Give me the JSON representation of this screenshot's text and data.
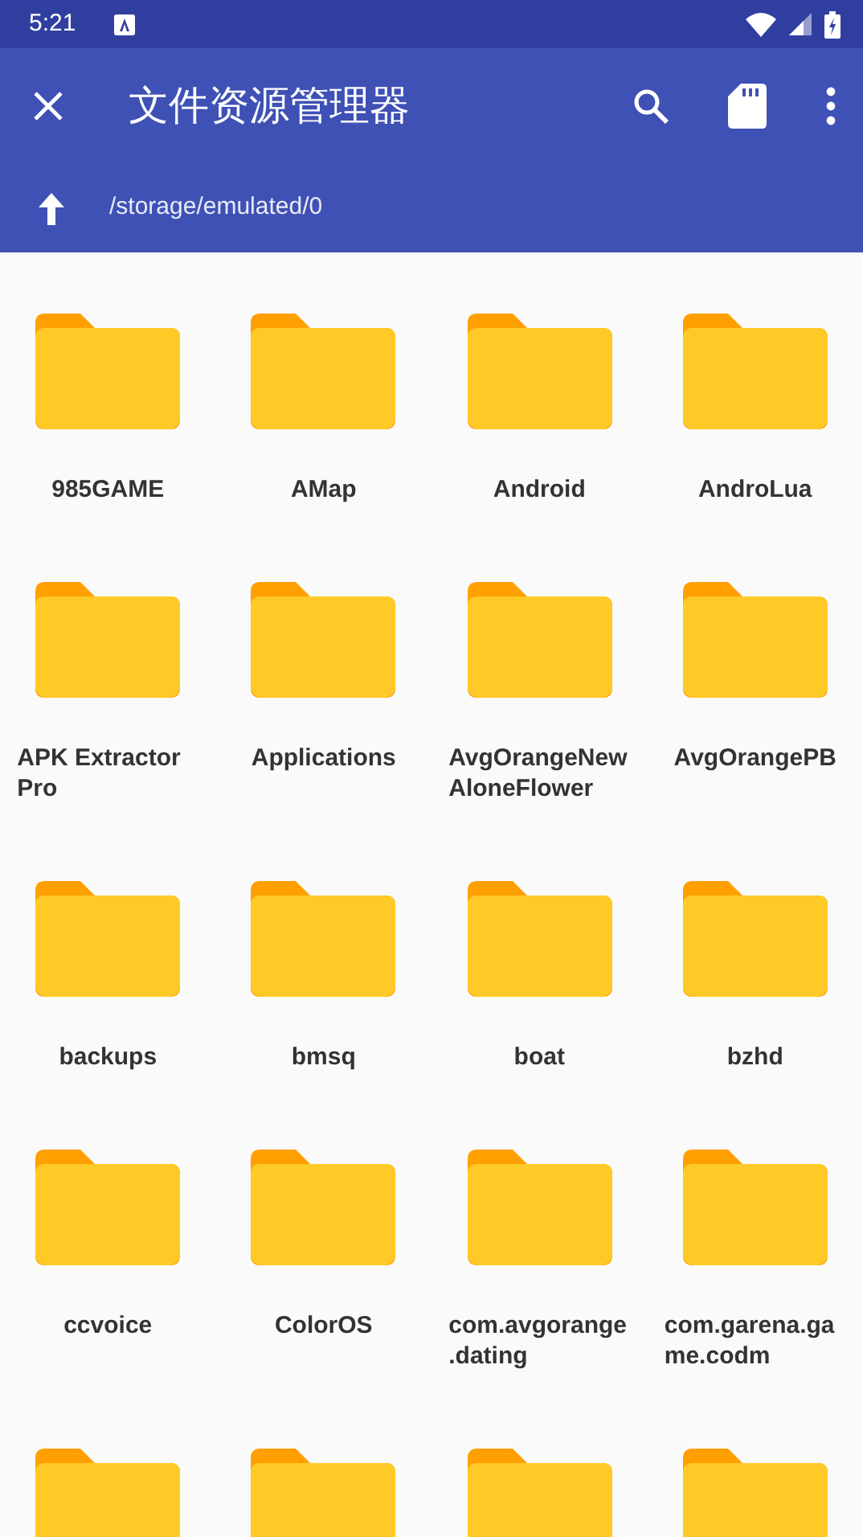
{
  "status_bar": {
    "time": "5:21"
  },
  "app_bar": {
    "title": "文件资源管理器"
  },
  "path_bar": {
    "path": "/storage/emulated/0"
  },
  "folders": [
    {
      "kind": "folder",
      "name": "985GAME"
    },
    {
      "kind": "folder",
      "name": "AMap"
    },
    {
      "kind": "folder",
      "name": "Android"
    },
    {
      "kind": "folder",
      "name": "AndroLua"
    },
    {
      "kind": "folder",
      "name": "APK Extractor Pro"
    },
    {
      "kind": "folder",
      "name": "Applications"
    },
    {
      "kind": "folder",
      "name": "AvgOrangeNewAloneFlower"
    },
    {
      "kind": "folder",
      "name": "AvgOrangePB"
    },
    {
      "kind": "folder",
      "name": "backups"
    },
    {
      "kind": "folder",
      "name": "bmsq"
    },
    {
      "kind": "folder",
      "name": "boat"
    },
    {
      "kind": "folder",
      "name": "bzhd"
    },
    {
      "kind": "folder",
      "name": "ccvoice"
    },
    {
      "kind": "folder",
      "name": "ColorOS"
    },
    {
      "kind": "folder",
      "name": "com.avgorange.dating"
    },
    {
      "kind": "folder",
      "name": "com.garena.game.codm"
    },
    {
      "kind": "folder"
    },
    {
      "kind": "folder"
    },
    {
      "kind": "folder"
    },
    {
      "kind": "folder"
    }
  ]
}
